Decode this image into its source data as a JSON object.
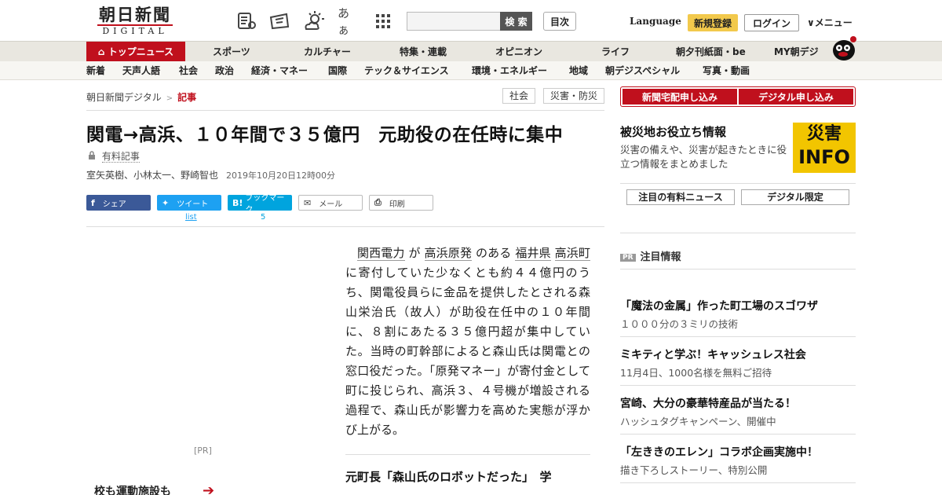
{
  "header": {
    "logo_jp": "朝日新聞",
    "logo_en": "DIGITAL",
    "kana_icon": "あぁ",
    "search_button": "検 索",
    "search_placeholder": "",
    "toc_button": "目次",
    "language": "Language",
    "register": "新規登録",
    "login": "ログイン",
    "menu": "メニュー"
  },
  "nav_main": [
    "トップニュース",
    "スポーツ",
    "カルチャー",
    "特集・連載",
    "オピニオン",
    "ライフ",
    "朝夕刊紙面・be",
    "MY朝デジ"
  ],
  "nav_sub": [
    "新着",
    "天声人語",
    "社会",
    "政治",
    "経済・マネー",
    "国際",
    "テック＆サイエンス",
    "環境・エネルギー",
    "地域",
    "朝デジスペシャル",
    "写真・動画"
  ],
  "breadcrumb": {
    "home": "朝日新聞デジタル",
    "sep": ">",
    "current": "記事"
  },
  "tags": [
    "社会",
    "災害・防災"
  ],
  "article": {
    "title": "関電→高浜、１０年間で３５億円　元助役の在任時に集中",
    "paid": "有料記事",
    "authors": "室矢英樹、小林太一、野崎智也",
    "date": "2019年10月20日12時00分",
    "body_parts": [
      "関西電力",
      " が ",
      "高浜原発",
      " のある ",
      "福井県",
      " ",
      "高浜町",
      " に寄付していた少なくとも約４４億円のうち、関電役員らに金品を提供したとされる森山栄治氏（故人）が助役在任中の１０年間に、８割にあたる３５億円超が集中していた。当時の町幹部によると森山氏は関電との窓口役だった。「原発マネー」が寄付金として町に投じられ、高浜３、４号機が増設される過程で、森山氏が影響力を高めた実態が浮かび上がる。"
    ],
    "related": "元町長「森山氏のロボットだった」　学"
  },
  "share": {
    "facebook": "シェア",
    "twitter": "ツイート",
    "twitter_sub": "list",
    "hatena": "ブックマーク",
    "hatena_icon": "B!",
    "hatena_sub": "5",
    "mail": "メール",
    "print": "印刷"
  },
  "left_ad": {
    "pr": "[PR]",
    "text": "校も運動施設も"
  },
  "sidebar": {
    "subscribe_paper": "新聞宅配申し込み",
    "subscribe_digital": "デジタル申し込み",
    "saigai_title": "被災地お役立ち情報",
    "saigai_desc": "災害の備えや、災害が起きたときに役立つ情報をまとめました",
    "saigai_img_top": "災害",
    "saigai_img_bottom": "INFO",
    "tab_paid_news": "注目の有料ニュース",
    "tab_digital": "デジタル限定",
    "pr_badge": "PR",
    "pr_heading": "注目情報",
    "pr_items": [
      {
        "title": "「魔法の金属」作った町工場のスゴワザ",
        "sub": "１０００分の３ミリの技術"
      },
      {
        "title": "ミキティと学ぶ！キャッシュレス社会",
        "sub": "11月4日、1000名様を無料ご招待"
      },
      {
        "title": "宮崎、大分の豪華特産品が当たる！",
        "sub": "ハッシュタグキャンペーン、開催中"
      },
      {
        "title": "「左ききのエレン」コラボ企画実施中！",
        "sub": "描き下ろしストーリー、特別公開"
      }
    ]
  },
  "colors": {
    "brand_red": "#c0101d",
    "register_yellow": "#f2c94c",
    "facebook": "#3b5998",
    "twitter": "#1da1f2",
    "hatena": "#00a4de"
  }
}
